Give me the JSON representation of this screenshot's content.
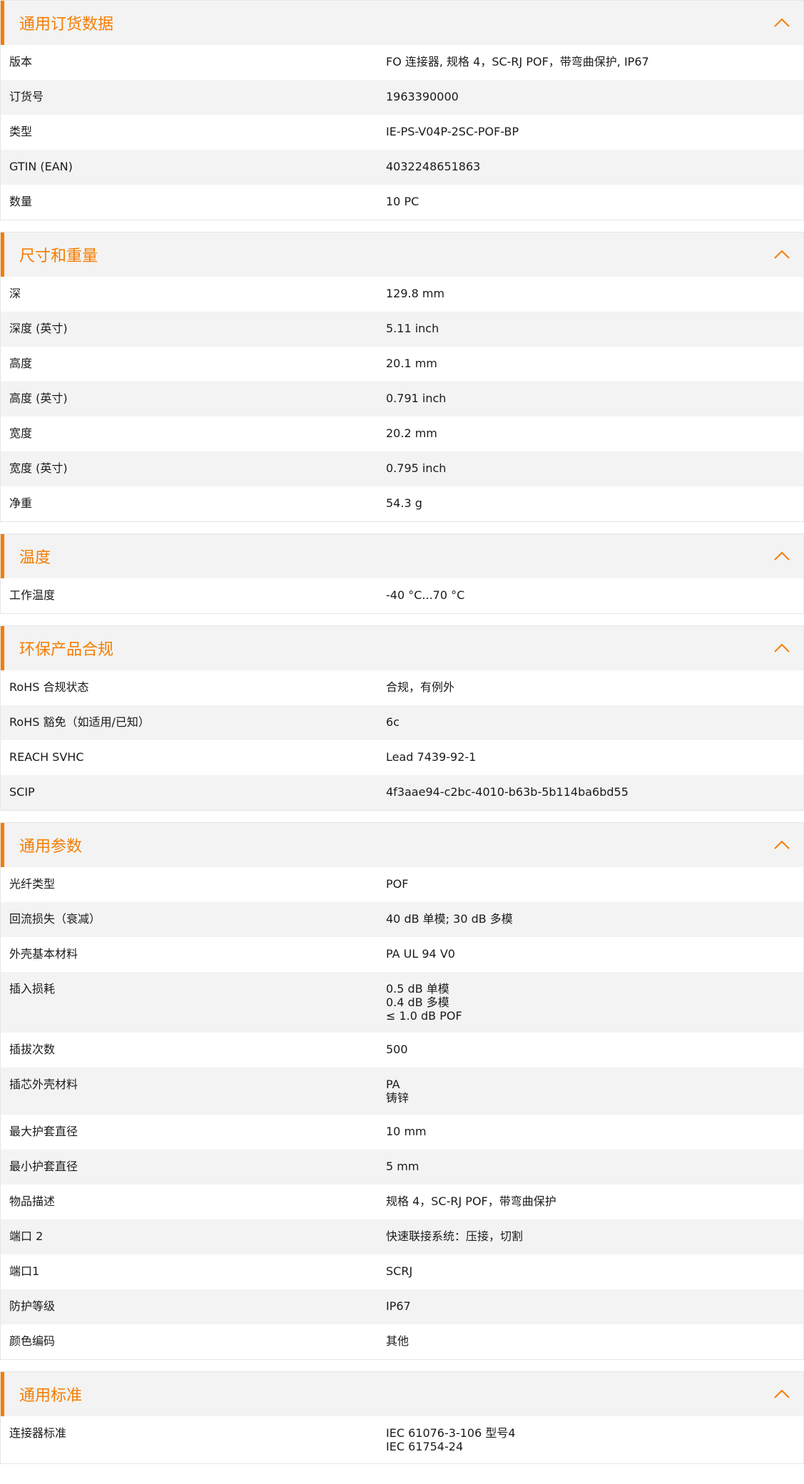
{
  "colors": {
    "accent": "#f57c00",
    "header_bg": "#f3f3f3",
    "row_alt_bg": "#f3f3f3"
  },
  "icons": {
    "collapse": "chevron-up-icon"
  },
  "sections": [
    {
      "title": "通用订货数据",
      "rows": [
        {
          "label": "版本",
          "value": "FO 连接器, 规格 4，SC-RJ POF，带弯曲保护, IP67"
        },
        {
          "label": "订货号",
          "value": "1963390000"
        },
        {
          "label": "类型",
          "value": "IE-PS-V04P-2SC-POF-BP"
        },
        {
          "label": "GTIN (EAN)",
          "value": "4032248651863"
        },
        {
          "label": "数量",
          "value": "10  PC"
        }
      ]
    },
    {
      "title": "尺寸和重量",
      "rows": [
        {
          "label": "深",
          "value": "129.8  mm"
        },
        {
          "label": "深度 (英寸)",
          "value": "5.11  inch"
        },
        {
          "label": "高度",
          "value": "20.1  mm"
        },
        {
          "label": "高度 (英寸)",
          "value": "0.791  inch"
        },
        {
          "label": "宽度",
          "value": "20.2  mm"
        },
        {
          "label": "宽度 (英寸)",
          "value": "0.795  inch"
        },
        {
          "label": "净重",
          "value": "54.3  g"
        }
      ]
    },
    {
      "title": "温度",
      "rows": [
        {
          "label": "工作温度",
          "value": "-40 °C...70 °C"
        }
      ]
    },
    {
      "title": "环保产品合规",
      "rows": [
        {
          "label": "RoHS 合规状态",
          "value": "合规，有例外"
        },
        {
          "label": "RoHS 豁免（如适用/已知）",
          "value": "6c"
        },
        {
          "label": "REACH SVHC",
          "value": "Lead 7439-92-1"
        },
        {
          "label": "SCIP",
          "value": "4f3aae94-c2bc-4010-b63b-5b114ba6bd55"
        }
      ]
    },
    {
      "title": "通用参数",
      "rows": [
        {
          "label": "光纤类型",
          "value": "POF"
        },
        {
          "label": "回流损失（衰减）",
          "value": "40 dB 单模; 30 dB 多模"
        },
        {
          "label": "外壳基本材料",
          "value": "PA UL 94 V0"
        },
        {
          "label": "插入损耗",
          "value": "0.5 dB 单模\n0.4 dB 多模\n≤ 1.0 dB POF"
        },
        {
          "label": "插拔次数",
          "value": "500"
        },
        {
          "label": "插芯外壳材料",
          "value": "PA\n铸锌"
        },
        {
          "label": "最大护套直径",
          "value": "10  mm"
        },
        {
          "label": "最小护套直径",
          "value": "5  mm"
        },
        {
          "label": "物品描述",
          "value": "规格 4，SC-RJ POF，带弯曲保护"
        },
        {
          "label": "端口 2",
          "value": "快速联接系统：压接，切割"
        },
        {
          "label": "端口1",
          "value": "SCRJ"
        },
        {
          "label": "防护等级",
          "value": "IP67"
        },
        {
          "label": "颜色编码",
          "value": "其他"
        }
      ]
    },
    {
      "title": "通用标准",
      "rows": [
        {
          "label": "连接器标准",
          "value": "IEC 61076-3-106 型号4\nIEC 61754-24"
        }
      ]
    }
  ]
}
